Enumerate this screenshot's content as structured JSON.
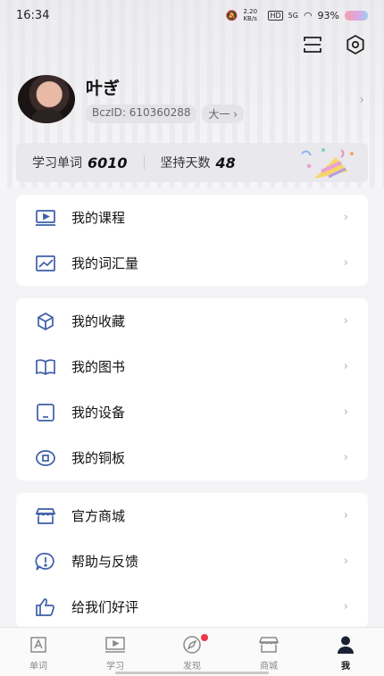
{
  "status_bar": {
    "time": "16:34",
    "network_speed": "2.20 KB/s",
    "hd": "HD",
    "signal": "5G",
    "battery": "93%"
  },
  "top_icons": [
    "scan-icon",
    "settings-icon"
  ],
  "profile": {
    "name": "叶ぎ",
    "id": "BczID: 610360288",
    "grade": "大一 ›"
  },
  "stats": {
    "words_label": "学习单词",
    "words_value": "6010",
    "days_label": "坚持天数",
    "days_value": "48"
  },
  "card1": [
    {
      "label": "我的课程",
      "icon": "course-icon"
    },
    {
      "label": "我的词汇量",
      "icon": "vocab-chart-icon"
    }
  ],
  "card2": [
    {
      "label": "我的收藏",
      "icon": "favorite-box-icon"
    },
    {
      "label": "我的图书",
      "icon": "book-icon"
    },
    {
      "label": "我的设备",
      "icon": "device-icon"
    },
    {
      "label": "我的铜板",
      "icon": "coin-icon"
    }
  ],
  "card3": [
    {
      "label": "官方商城",
      "icon": "store-icon"
    },
    {
      "label": "帮助与反馈",
      "icon": "help-icon"
    },
    {
      "label": "给我们好评",
      "icon": "thumbs-up-icon"
    }
  ],
  "tabbar": [
    {
      "label": "单词",
      "icon": "word-icon"
    },
    {
      "label": "学习",
      "icon": "study-icon"
    },
    {
      "label": "发现",
      "icon": "compass-icon"
    },
    {
      "label": "商城",
      "icon": "shop-icon"
    },
    {
      "label": "我",
      "icon": "person-icon"
    }
  ],
  "colors": {
    "accent_icon": "#3c5fa8",
    "badge_red": "#e8394a"
  }
}
